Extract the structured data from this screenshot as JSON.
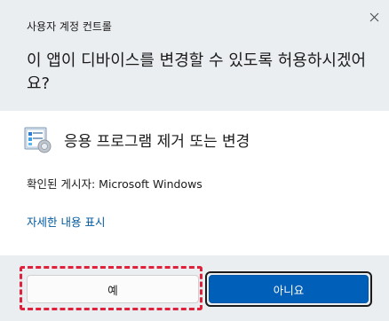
{
  "dialog": {
    "title": "사용자 계정 컨트롤",
    "question": "이 앱이 디바이스를 변경할 수 있도록 허용하시겠어요?",
    "close_icon": "close-icon",
    "close_glyph": "✕"
  },
  "app": {
    "icon": "programs-features-icon",
    "name": "응용 프로그램 제거 또는 변경"
  },
  "publisher": {
    "text": "확인된 게시자: Microsoft Windows"
  },
  "details_link": {
    "text": "자세한 내용 표시"
  },
  "buttons": {
    "yes_label": "예",
    "no_label": "아니요"
  },
  "colors": {
    "header_bg": "#ebeef1",
    "footer_bg": "#ebeef1",
    "primary_button": "#005fb8",
    "link": "#005a9e",
    "highlight": "#e0213b"
  }
}
